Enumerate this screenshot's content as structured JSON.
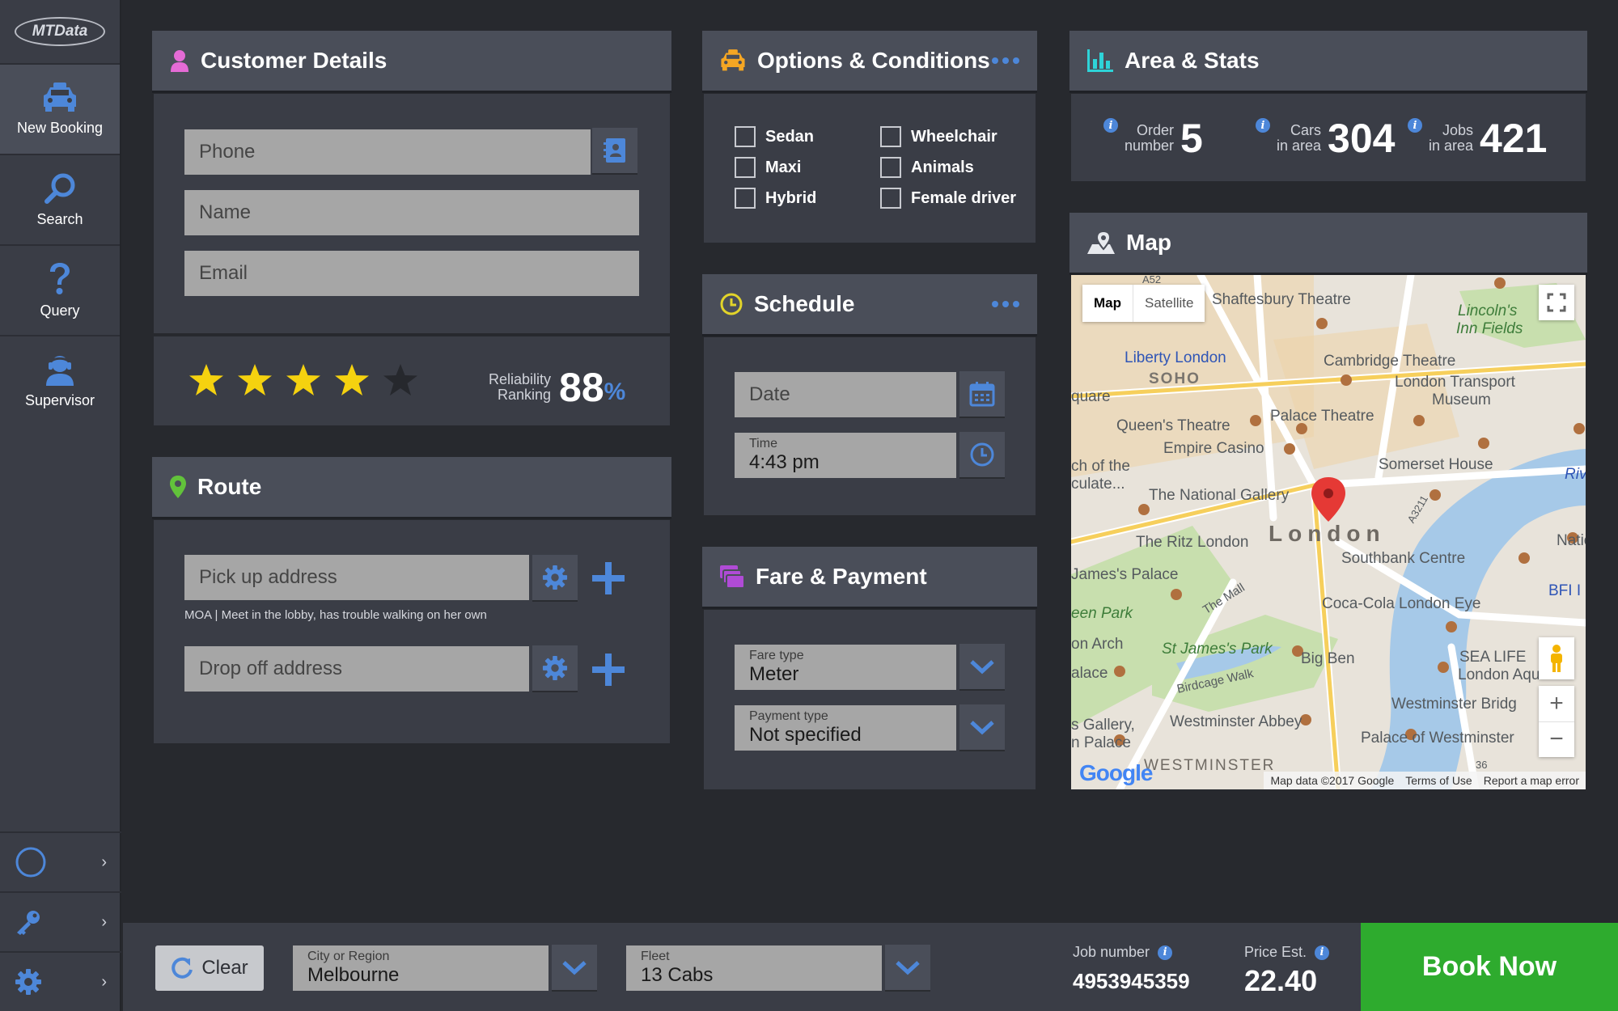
{
  "app": {
    "logo_text": "MTData"
  },
  "sidebar": {
    "items": [
      {
        "label": "New Booking",
        "icon": "taxi-icon"
      },
      {
        "label": "Search",
        "icon": "search-icon"
      },
      {
        "label": "Query",
        "icon": "question-icon"
      },
      {
        "label": "Supervisor",
        "icon": "supervisor-icon"
      }
    ],
    "bottom": [
      {
        "icon": "circle-icon",
        "arrow": "›"
      },
      {
        "icon": "key-icon",
        "arrow": "›"
      },
      {
        "icon": "gear-icon",
        "arrow": "›"
      }
    ]
  },
  "customer": {
    "title": "Customer Details",
    "phone_placeholder": "Phone",
    "name_placeholder": "Name",
    "email_placeholder": "Email",
    "rating_stars": 4,
    "rating_max": 5,
    "reliability_line1": "Reliability",
    "reliability_line2": "Ranking",
    "reliability_value": "88",
    "reliability_unit": "%"
  },
  "route": {
    "title": "Route",
    "pickup_placeholder": "Pick up address",
    "pickup_note": "MOA | Meet in the lobby, has trouble walking on her own",
    "dropoff_placeholder": "Drop off address"
  },
  "options": {
    "title": "Options & Conditions",
    "col1": [
      "Sedan",
      "Maxi",
      "Hybrid"
    ],
    "col2": [
      "Wheelchair",
      "Animals",
      "Female driver"
    ]
  },
  "schedule": {
    "title": "Schedule",
    "date_placeholder": "Date",
    "time_label": "Time",
    "time_value": "4:43 pm"
  },
  "fare": {
    "title": "Fare & Payment",
    "fare_type_label": "Fare type",
    "fare_type_value": "Meter",
    "payment_type_label": "Payment type",
    "payment_type_value": "Not specified"
  },
  "stats": {
    "title": "Area & Stats",
    "order_l1": "Order",
    "order_l2": "number",
    "order_value": "5",
    "cars_l1": "Cars",
    "cars_l2": "in area",
    "cars_value": "304",
    "jobs_l1": "Jobs",
    "jobs_l2": "in area",
    "jobs_value": "421"
  },
  "map": {
    "title": "Map",
    "tab_map": "Map",
    "tab_satellite": "Satellite",
    "labels": {
      "shaftesbury": "Shaftesbury Theatre",
      "lincolns": "Lincoln's",
      "inn_fields": "Inn Fields",
      "liberty": "Liberty London",
      "soho": "SOHO",
      "quare": "quare",
      "cambridge": "Cambridge Theatre",
      "ltm1": "London Transport",
      "ltm2": "Museum",
      "queens": "Queen's Theatre",
      "palace": "Palace Theatre",
      "empire": "Empire Casino",
      "somerset": "Somerset House",
      "ch_of_the": "ch of the",
      "culate": "culate...",
      "national_gallery": "The National Gallery",
      "ritz": "The Ritz London",
      "london": "London",
      "natio": "Natio",
      "southbank": "Southbank Centre",
      "james_palace": "James's Palace",
      "bfi": "BFI I",
      "een_park": "een Park",
      "the_mall": "The Mall",
      "coca_cola": "Coca-Cola London Eye",
      "on_arch": "on Arch",
      "st_james_park": "St James's Park",
      "sea_life1": "SEA LIFE",
      "sea_life2": "London Aqua",
      "alace": "alace",
      "birdcage": "Birdcage Walk",
      "big_ben": "Big Ben",
      "westminster_bridge": "Westminster Bridg",
      "gallery": "s Gallery,",
      "westminster_abbey": "Westminster Abbey",
      "n_palace": "n Palace",
      "palace_westminster": "Palace of Westminster",
      "westminster": "WESTMINSTER",
      "a52": "A52",
      "a3211": "A3211",
      "riv": "Riv",
      "road_36": "36"
    },
    "attribution": "Map data ©2017 Google",
    "terms": "Terms of Use",
    "report": "Report a map error",
    "google": "Google",
    "zoom_in": "+",
    "zoom_out": "−"
  },
  "bottom": {
    "clear_label": "Clear",
    "city_label": "City or Region",
    "city_value": "Melbourne",
    "fleet_label": "Fleet",
    "fleet_value": "13 Cabs",
    "job_label": "Job number",
    "job_value": "4953945359",
    "price_label": "Price Est.",
    "price_value": "22.40",
    "book_label": "Book Now"
  },
  "colors": {
    "accent_blue": "#4d87d9",
    "book_green": "#2eab2e",
    "panel_head": "#4a4e59",
    "panel_body": "#3a3d46",
    "star_yellow": "#f5d20f",
    "customer_pink": "#e56bd6",
    "route_green": "#62c23b",
    "options_orange": "#f5a623",
    "schedule_yellow": "#e2d42a",
    "fare_purple": "#b04bd6",
    "stats_cyan": "#2ed3d8"
  }
}
